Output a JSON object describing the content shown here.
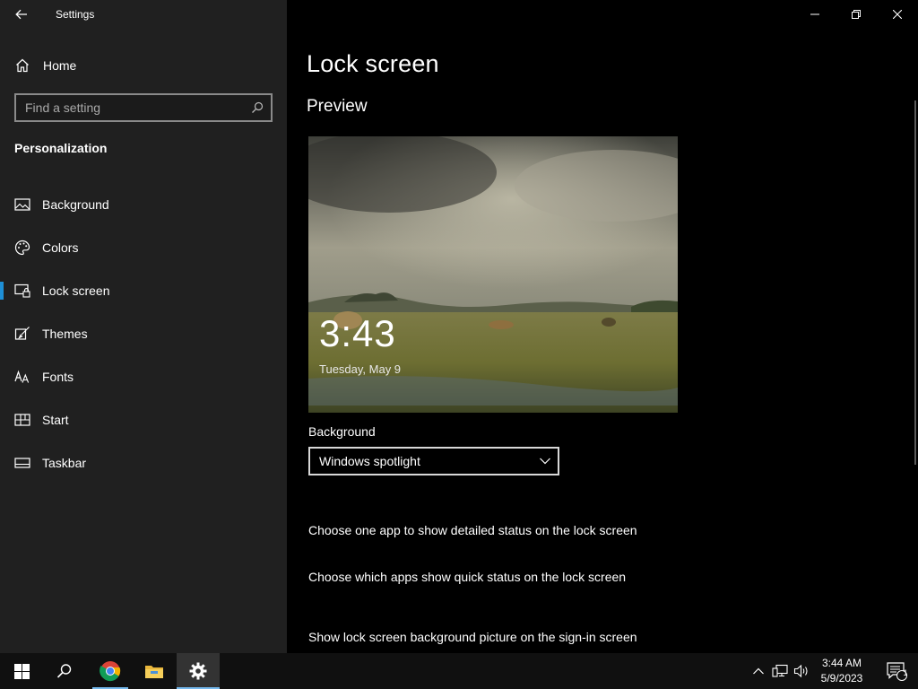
{
  "window": {
    "title": "Settings",
    "controls": [
      "minimize",
      "restore",
      "close"
    ]
  },
  "sidebar": {
    "home_label": "Home",
    "search_placeholder": "Find a setting",
    "section_title": "Personalization",
    "items": [
      {
        "label": "Background",
        "icon": "picture-icon"
      },
      {
        "label": "Colors",
        "icon": "palette-icon"
      },
      {
        "label": "Lock screen",
        "icon": "lock-screen-icon",
        "selected": true
      },
      {
        "label": "Themes",
        "icon": "brush-icon"
      },
      {
        "label": "Fonts",
        "icon": "font-icon"
      },
      {
        "label": "Start",
        "icon": "start-icon"
      },
      {
        "label": "Taskbar",
        "icon": "taskbar-icon"
      }
    ]
  },
  "main": {
    "title": "Lock screen",
    "preview_title": "Preview",
    "preview_time": "3:43",
    "preview_date": "Tuesday, May 9",
    "background_label": "Background",
    "background_value": "Windows spotlight",
    "link_detailed_status": "Choose one app to show detailed status on the lock screen",
    "link_quick_status": "Choose which apps show quick status on the lock screen",
    "link_signin_picture": "Show lock screen background picture on the sign-in screen"
  },
  "taskbar": {
    "apps": [
      "start-icon",
      "search-icon",
      "chrome-icon",
      "file-explorer-icon",
      "settings-gear-icon"
    ],
    "clock_time": "3:44 AM",
    "clock_date": "5/9/2023",
    "notification_count": "1",
    "colors": {
      "accent": "#76b9ed",
      "selection": "#1e8fd6"
    }
  }
}
